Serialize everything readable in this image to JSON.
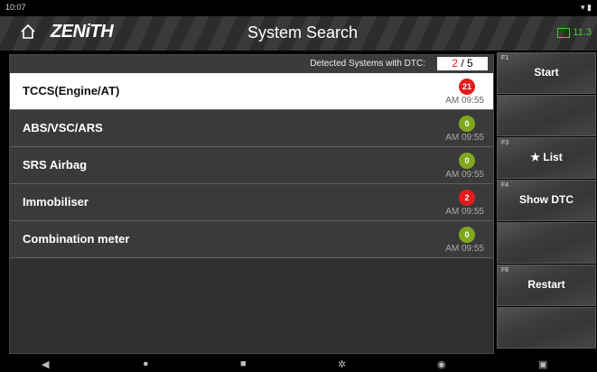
{
  "status": {
    "time": "10:07"
  },
  "header": {
    "logo": "ZENiTH",
    "title": "System Search",
    "battery": "11.3"
  },
  "detect": {
    "label": "Detected Systems with DTC:",
    "dtc": "2",
    "sep": "/",
    "total": "5"
  },
  "systems": [
    {
      "name": "TCCS(Engine/AT)",
      "count": "21",
      "status": "red",
      "time": "AM 09:55"
    },
    {
      "name": "ABS/VSC/ARS",
      "count": "0",
      "status": "green",
      "time": "AM 09:55"
    },
    {
      "name": "SRS Airbag",
      "count": "0",
      "status": "green",
      "time": "AM 09:55"
    },
    {
      "name": "Immobiliser",
      "count": "2",
      "status": "red",
      "time": "AM 09:55"
    },
    {
      "name": "Combination meter",
      "count": "0",
      "status": "green",
      "time": "AM 09:55"
    }
  ],
  "fkeys": [
    {
      "key": "F1",
      "label": "Start"
    },
    {
      "key": "",
      "label": ""
    },
    {
      "key": "F3",
      "label": "★ List"
    },
    {
      "key": "F4",
      "label": "Show DTC"
    },
    {
      "key": "",
      "label": ""
    },
    {
      "key": "F6",
      "label": "Restart"
    },
    {
      "key": "",
      "label": ""
    }
  ],
  "colors": {
    "dtc_red": "#e31b1b",
    "ok_green": "#7fa81e",
    "battery_green": "#3fcf2f"
  },
  "navbar": {
    "icons": [
      "back-icon",
      "home-dot-icon",
      "recents-icon",
      "settings-gear-icon",
      "browser-icon",
      "screenshot-icon"
    ]
  }
}
